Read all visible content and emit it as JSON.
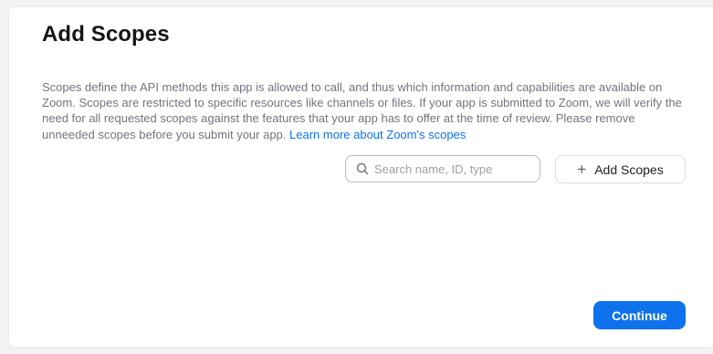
{
  "dialog": {
    "title": "Add Scopes",
    "description": "Scopes define the API methods this app is allowed to call, and thus which information and capabilities are available on Zoom. Scopes are restricted to specific resources like channels or files. If your app is submitted to Zoom, we will verify the need for all requested scopes against the features that your app has to offer at the time of review. Please remove unneeded scopes before you submit your app.",
    "learn_more_link": "Learn more about Zoom's scopes"
  },
  "search": {
    "placeholder": "Search name, ID, type",
    "value": "",
    "icon": "search-icon"
  },
  "actions": {
    "add_scopes_label": "Add Scopes",
    "add_icon": "plus-icon",
    "continue_label": "Continue"
  },
  "colors": {
    "primary": "#0e72ed",
    "link": "#0e72ed",
    "text_secondary": "#6e7680",
    "title": "#131619"
  }
}
